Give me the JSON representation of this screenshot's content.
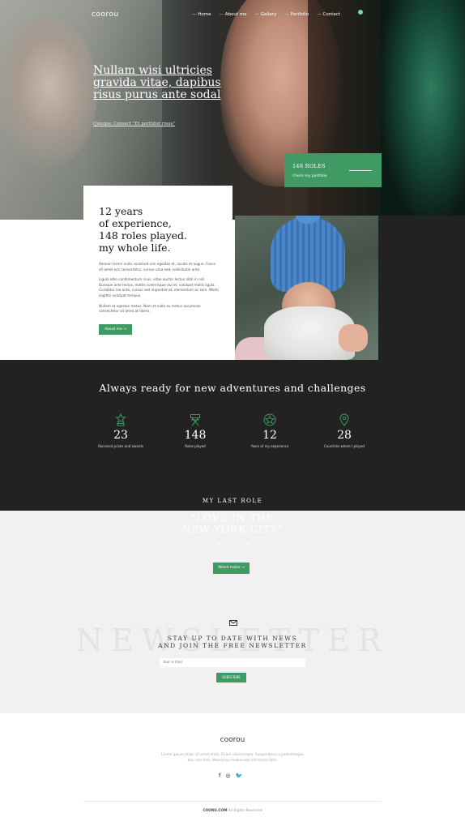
{
  "header": {
    "logo": "coorou",
    "nav": [
      "Home",
      "About me",
      "Gallery",
      "Portfolio",
      "Contact"
    ]
  },
  "hero": {
    "title": "Nullam wisi ultricies gravida vitae, dapibus risus purus ante sodal",
    "subtitle": "Quisque Consect \"Et porttitor risus\"",
    "roles_box": {
      "title": "148 ROLES",
      "link": "Check my portfolio"
    }
  },
  "about": {
    "heading_lines": [
      "12 years",
      "of experience,",
      "148 roles played.",
      "my whole life."
    ],
    "paragraphs": [
      "Aenean lorem nulla, euismod non egestas et, iaculis et augue. Fusce sit amet orci consectetur, cursus urna sed, sollicitudin ante.",
      "Ligula odio condimentum risus, vitae auctor lectus nibh in nisl. Quisque ante lectus, mattis scelerisque dui et, volutpat mollis ligula. Curabitur leo ante, cursus sed imperdiet at, elementum ac sem. Morbi sagittis volutpat tempus.",
      "Nullam at egestas metus. Nam et nulla eu metus accumsan consectetur sit amet at libero."
    ],
    "button": "About me →"
  },
  "stats": {
    "title": "Always ready for new adventures and challenges",
    "items": [
      {
        "icon": "award-icon",
        "value": "23",
        "label": "Received prizes and awards"
      },
      {
        "icon": "director-chair-icon",
        "value": "148",
        "label": "Roles played"
      },
      {
        "icon": "star-icon",
        "value": "12",
        "label": "Years of my experience"
      },
      {
        "icon": "location-pin-icon",
        "value": "28",
        "label": "Countries where I played"
      }
    ],
    "section_heading": "MY LAST ROLE"
  },
  "last_role": {
    "movie_title_lines": [
      "\"LOVE IN THE",
      "NEW YORK CITY\""
    ],
    "button": "Watch trailer →"
  },
  "newsletter": {
    "background_word": "NEWSLETTER",
    "heading_lines": [
      "STAY UP TO DATE WITH NEWS",
      "AND JOIN THE FREE NEWSLETTER"
    ],
    "input_placeholder": "Your e-mail",
    "button": "SUBSCRIBE"
  },
  "footer": {
    "logo": "coorou",
    "text": "Lorem ipsum dolor sit amet enim. Etiam ullamcorper. Suspendisse a pellentesque dui, non felis. Maecenas malesuada elit lectus felis.",
    "social": [
      "f",
      "◎",
      "🐦"
    ],
    "copyright_brand": "COORU.COM",
    "copyright_text": "All Rights Reserved"
  },
  "colors": {
    "accent": "#3f9a64",
    "dark": "#222222",
    "light": "#f1f1f1"
  }
}
